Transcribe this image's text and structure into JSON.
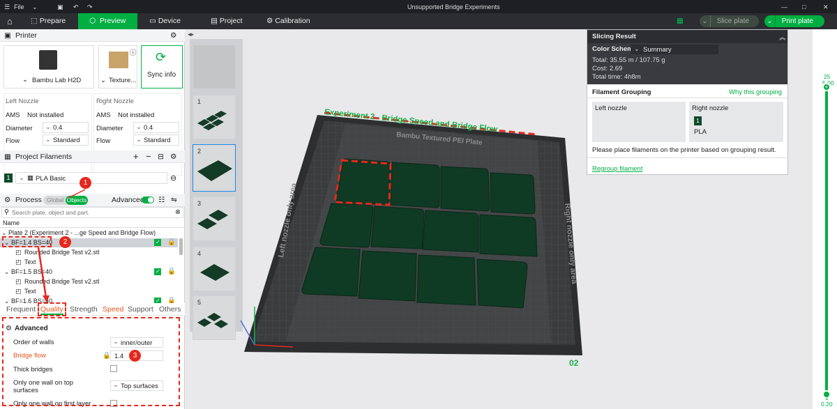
{
  "titlebar": {
    "file_label": "File",
    "title": "Unsupported Bridge Experiments"
  },
  "nav": {
    "tabs": [
      {
        "label": "Prepare"
      },
      {
        "label": "Preview"
      },
      {
        "label": "Device"
      },
      {
        "label": "Project"
      },
      {
        "label": "Calibration"
      }
    ],
    "slice_label": "Slice plate",
    "print_label": "Print plate"
  },
  "printer": {
    "section_title": "Printer",
    "model": "Bambu Lab H2D",
    "plate": "Texture...",
    "sync_label": "Sync info",
    "left_nozzle": {
      "title": "Left Nozzle",
      "ams_label": "AMS",
      "ams_value": "Not installed",
      "diameter_label": "Diameter",
      "diameter_value": "0.4",
      "flow_label": "Flow",
      "flow_value": "Standard"
    },
    "right_nozzle": {
      "title": "Right Nozzle",
      "ams_label": "AMS",
      "ams_value": "Not installed",
      "diameter_label": "Diameter",
      "diameter_value": "0.4",
      "flow_label": "Flow",
      "flow_value": "Standard"
    }
  },
  "filaments": {
    "section_title": "Project Filaments",
    "items": [
      {
        "index": "1",
        "name": "PLA Basic",
        "color": "#0e4a2a"
      }
    ]
  },
  "process": {
    "section_title": "Process",
    "global_label": "Global",
    "objects_label": "Objects",
    "advanced_label": "Advanced",
    "search_placeholder": "Search plate, object and part.",
    "name_header": "Name",
    "tree": [
      {
        "text": "Plate 2 (Experiment 2 - ...ge Speed and Bridge Flow)"
      },
      {
        "text": "BF=1.4 BS=40"
      },
      {
        "text": "Rounded Bridge Test v2.stl"
      },
      {
        "text": "Text"
      },
      {
        "text": "BF=1.5 BS=40"
      },
      {
        "text": "Rounded Bridge Test v2.stl"
      },
      {
        "text": "Text"
      },
      {
        "text": "BF=1.6 BS=40"
      }
    ]
  },
  "tabs": [
    {
      "label": "Frequent"
    },
    {
      "label": "Quality"
    },
    {
      "label": "Strength"
    },
    {
      "label": "Speed"
    },
    {
      "label": "Support"
    },
    {
      "label": "Others"
    }
  ],
  "settings": {
    "group_title": "Advanced",
    "order_walls_label": "Order of walls",
    "order_walls_value": "inner/outer",
    "bridge_flow_label": "Bridge flow",
    "bridge_flow_value": "1.4",
    "thick_bridges_label": "Thick bridges",
    "one_wall_top_label_1": "Only one wall on top",
    "one_wall_top_label_2": "surfaces",
    "one_wall_top_value": "Top surfaces",
    "one_wall_first_label": "Only one wall on first layer"
  },
  "annotations": {
    "b1": "1",
    "b2": "2",
    "b3": "3"
  },
  "thumbnails": [
    {
      "n": "1"
    },
    {
      "n": "2"
    },
    {
      "n": "3"
    },
    {
      "n": "4"
    },
    {
      "n": "5"
    }
  ],
  "plate": {
    "experiment_label": "Experiment 2 - Bridge Speed and Bridge Flow",
    "brand": "Bambu Textured PEI Plate",
    "left_zone": "Left nozzle only area",
    "right_zone": "Right nozzle only area",
    "plate_number": "02"
  },
  "slicing": {
    "title": "Slicing Result",
    "color_scheme_label": "Color Scheme",
    "color_scheme_value": "Summary",
    "total": "Total:   35.55 m / 107.75 g",
    "cost": "Cost:   2.69",
    "time": "Total time:   4h8m",
    "grouping_title": "Filament Grouping",
    "why_link": "Why this grouping",
    "left_nozzle": "Left nozzle",
    "right_nozzle": "Right nozzle",
    "filament_index": "1",
    "filament_type": "PLA",
    "note": "Please place filaments on the printer based on grouping result.",
    "regroup": "Regroup filament"
  },
  "layer_slider": {
    "top_layer": "25",
    "top_height": "5.00",
    "bottom_layer": "1",
    "bottom_height": "0.20"
  },
  "colors": {
    "accent": "#00ae42",
    "annotation": "#e5281d",
    "filament": "#0e4a2a"
  }
}
